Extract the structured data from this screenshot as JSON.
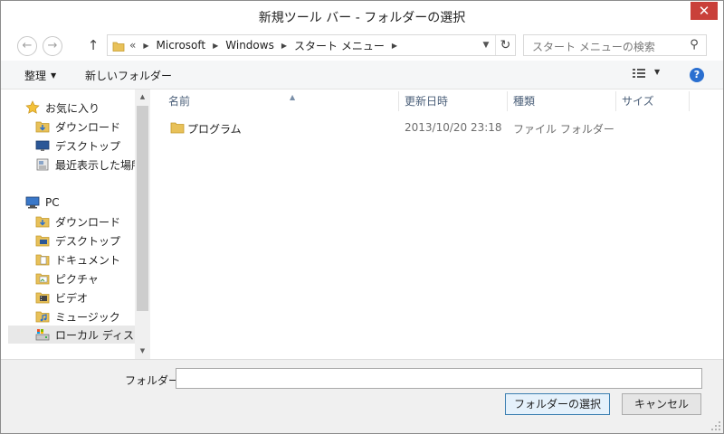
{
  "window": {
    "title": "新規ツール バー - フォルダーの選択",
    "close_glyph": "✕"
  },
  "navigation": {
    "back_glyph": "←",
    "forward_glyph": "→",
    "up_glyph": "↑",
    "overflow_glyph": "«",
    "breadcrumb": [
      "Microsoft",
      "Windows",
      "スタート メニュー"
    ],
    "refresh_glyph": "↻",
    "search_placeholder": "スタート メニューの検索",
    "search_glyph": "⚲"
  },
  "toolbar": {
    "organize_label": "整理",
    "new_folder_label": "新しいフォルダー",
    "help_glyph": "?"
  },
  "sidebar": {
    "favorites_label": "お気に入り",
    "favorites": [
      {
        "label": "ダウンロード",
        "icon": "download-folder-icon"
      },
      {
        "label": "デスクトップ",
        "icon": "desktop-icon"
      },
      {
        "label": "最近表示した場所",
        "icon": "recent-places-icon"
      }
    ],
    "pc_label": "PC",
    "pc_items": [
      {
        "label": "ダウンロード",
        "icon": "download-folder-icon"
      },
      {
        "label": "デスクトップ",
        "icon": "desktop-folder-icon"
      },
      {
        "label": "ドキュメント",
        "icon": "documents-folder-icon"
      },
      {
        "label": "ピクチャ",
        "icon": "pictures-folder-icon"
      },
      {
        "label": "ビデオ",
        "icon": "videos-folder-icon"
      },
      {
        "label": "ミュージック",
        "icon": "music-folder-icon"
      },
      {
        "label": "ローカル ディスク (C",
        "icon": "local-disk-icon"
      }
    ]
  },
  "file_list": {
    "columns": [
      "名前",
      "更新日時",
      "種類",
      "サイズ"
    ],
    "rows": [
      {
        "name": "プログラム",
        "modified": "2013/10/20 23:18",
        "type": "ファイル フォルダー",
        "size": ""
      }
    ]
  },
  "footer": {
    "folder_label": "フォルダー:",
    "folder_value": "",
    "select_button": "フォルダーの選択",
    "cancel_button": "キャンセル"
  },
  "colors": {
    "accent": "#2a6fd0",
    "folder_yellow": "#e8c159",
    "close_red": "#c9403a",
    "header_text": "#4c607a",
    "muted_text": "#6d6d6d"
  }
}
